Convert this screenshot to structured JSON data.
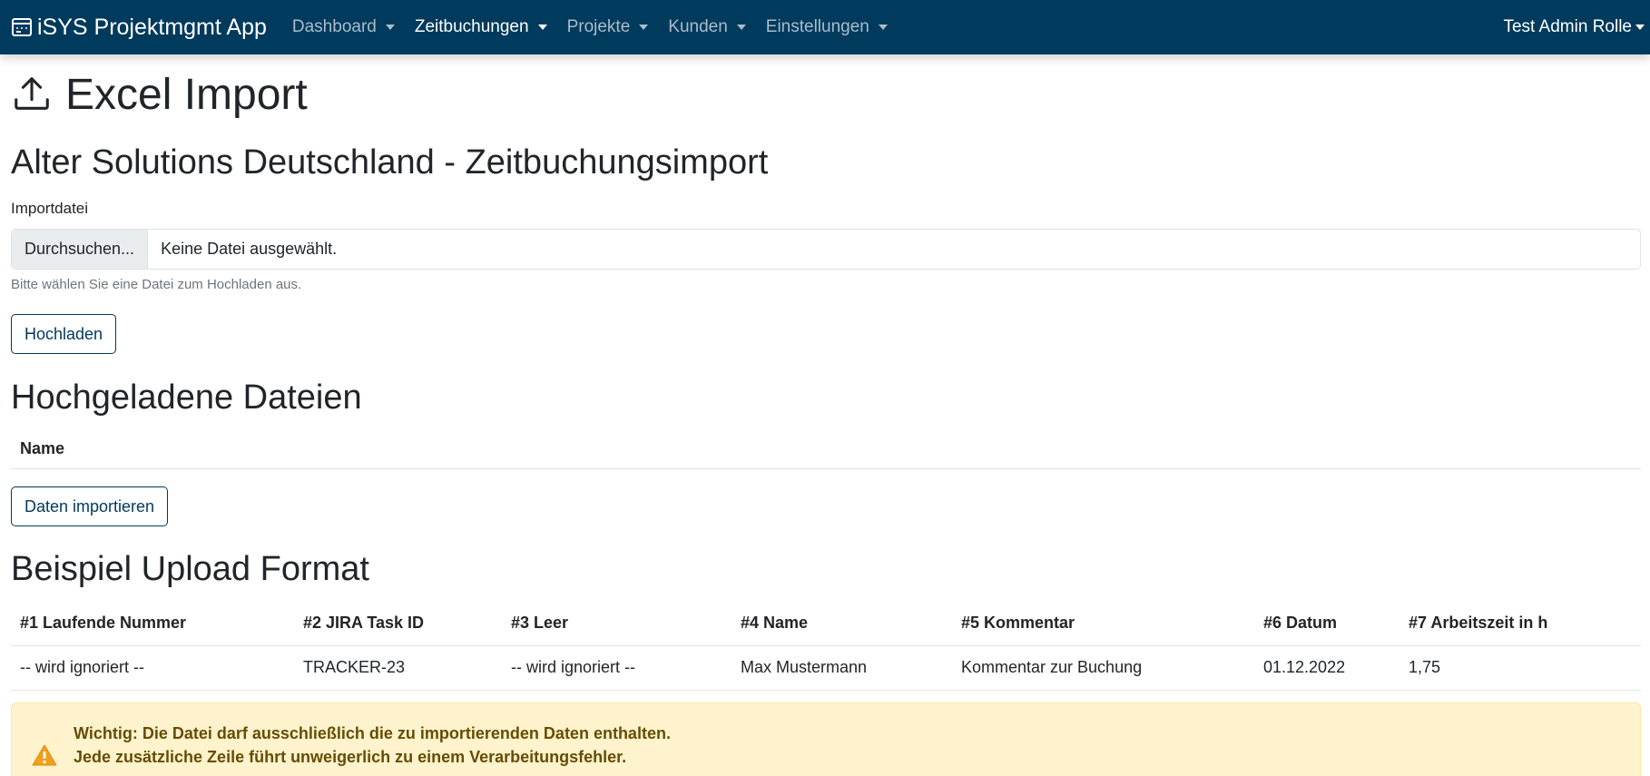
{
  "navbar": {
    "brand": "iSYS Projektmgmt App",
    "brand_icon": "calendar-icon",
    "items": [
      {
        "label": "Dashboard",
        "active": false
      },
      {
        "label": "Zeitbuchungen",
        "active": true
      },
      {
        "label": "Projekte",
        "active": false
      },
      {
        "label": "Kunden",
        "active": false
      },
      {
        "label": "Einstellungen",
        "active": false
      }
    ],
    "user": "Test Admin Rolle"
  },
  "page": {
    "title": "Excel Import",
    "title_icon": "upload-icon"
  },
  "import_section": {
    "heading": "Alter Solutions Deutschland - Zeitbuchungsimport",
    "file_label": "Importdatei",
    "browse_label": "Durchsuchen...",
    "file_status": "Keine Datei ausgewählt.",
    "help_text": "Bitte wählen Sie eine Datei zum Hochladen aus.",
    "upload_button": "Hochladen"
  },
  "uploaded_section": {
    "heading": "Hochgeladene Dateien",
    "column_name": "Name",
    "import_button": "Daten importieren"
  },
  "example_section": {
    "heading": "Beispiel Upload Format",
    "headers": [
      "#1 Laufende Nummer",
      "#2 JIRA Task ID",
      "#3 Leer",
      "#4 Name",
      "#5 Kommentar",
      "#6 Datum",
      "#7 Arbeitszeit in h"
    ],
    "rows": [
      [
        "-- wird ignoriert --",
        "TRACKER-23",
        "-- wird ignoriert --",
        "Max Mustermann",
        "Kommentar zur Buchung",
        "01.12.2022",
        "1,75"
      ]
    ]
  },
  "alert": {
    "icon": "warning-icon",
    "line1": "Wichtig: Die Datei darf ausschließlich die zu importierenden Daten enthalten.",
    "line2": "Jede zusätzliche Zeile führt unweigerlich zu einem Verarbeitungsfehler.",
    "color": "#fff3cd"
  },
  "colors": {
    "navbar": "#003a5c",
    "accent": "#003a5c"
  }
}
